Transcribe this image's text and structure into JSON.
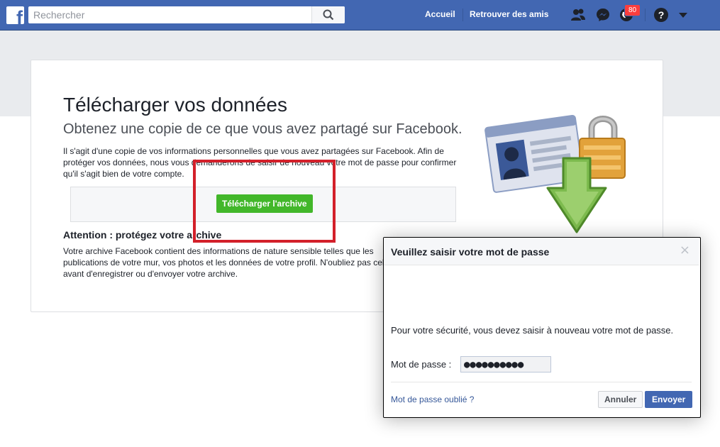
{
  "topbar": {
    "search_placeholder": "Rechercher",
    "nav_home": "Accueil",
    "nav_find_friends": "Retrouver des amis",
    "notification_count": "80",
    "icons": [
      "facebook-logo-icon",
      "search-icon",
      "friend-requests-icon",
      "messenger-icon",
      "notifications-globe-icon",
      "help-icon",
      "chevron-down-icon"
    ],
    "brand_color": "#4267b2"
  },
  "main": {
    "title": "Télécharger vos données",
    "subtitle": "Obtenez une copie de ce que vous avez partagé sur Facebook.",
    "description": "Il s'agit d'une copie de vos informations personnelles que vous avez partagées sur Facebook. Afin de protéger vos données, nous vous demanderons de saisir de nouveau votre mot de passe pour confirmer qu'il s'agit bien de votre compte.",
    "download_button": "Télécharger l'archive",
    "download_button_color": "#42b72a",
    "warning_title": "Attention : protégez votre archive",
    "warning_text": "Votre archive Facebook contient des informations de nature sensible telles que les publications de votre mur, vos photos et les données de votre profil. N'oubliez pas cela avant d'enregistrer ou d'envoyer votre archive.",
    "highlight_color": "#d3202a"
  },
  "dialog": {
    "title": "Veuillez saisir votre mot de passe",
    "message": "Pour votre sécurité, vous devez saisir à nouveau votre mot de passe.",
    "password_label": "Mot de passe :",
    "password_value": "●●●●●●●●●●",
    "forgot_link": "Mot de passe oublié ?",
    "cancel_button": "Annuler",
    "submit_button": "Envoyer"
  }
}
